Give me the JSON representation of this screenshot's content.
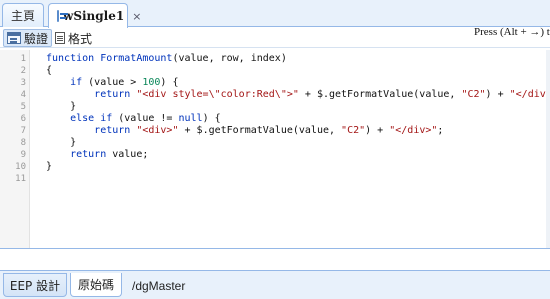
{
  "tabs": {
    "home_label": "主頁",
    "active_label": "wSingle1",
    "close_glyph": "×"
  },
  "toolbar": {
    "verify_label": "驗證",
    "format_label": "格式",
    "hint": "Press (Alt + →) to"
  },
  "editor": {
    "line_numbers": [
      "1",
      "2",
      "3",
      "4",
      "5",
      "6",
      "7",
      "8",
      "9",
      "10",
      "11"
    ]
  },
  "bottom": {
    "design_tab": "EEP 設計",
    "source_tab": "原始碼",
    "path": "/dgMaster"
  },
  "colors": {
    "accent_border": "#95b8e7",
    "tab_bg": "#e8f1fb",
    "keyword": "#0033bb",
    "string": "#a31515",
    "number": "#098658"
  }
}
